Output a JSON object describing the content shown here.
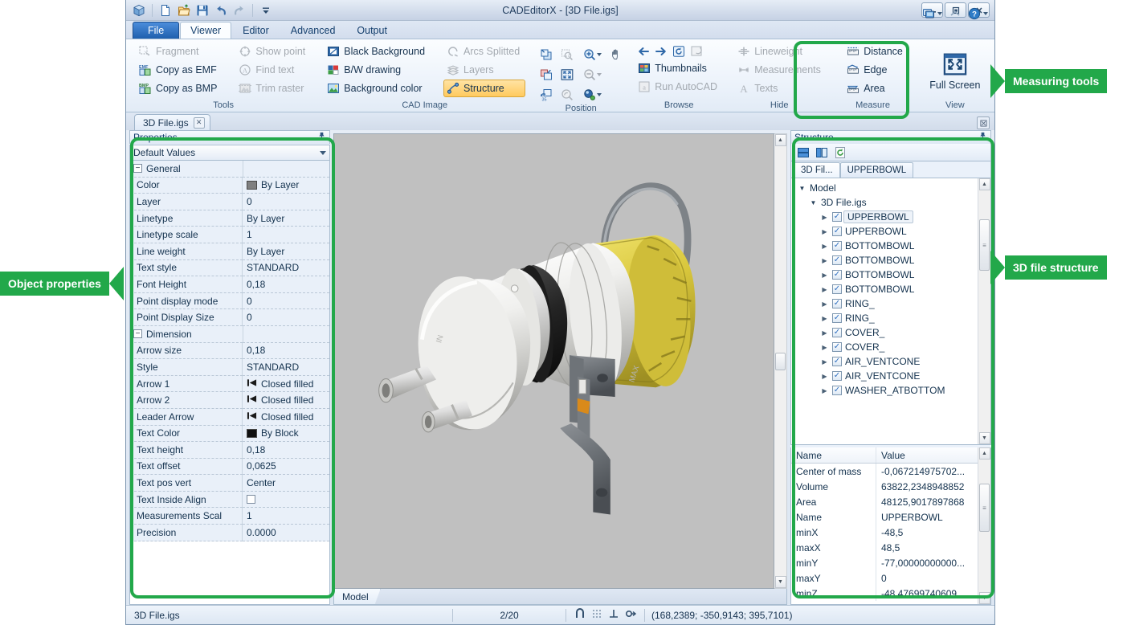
{
  "window": {
    "title": "CADEditorX - [3D File.igs]",
    "minimize": "—",
    "maximize": "□",
    "close": "✕"
  },
  "quick_access": {
    "items": [
      "app-logo",
      "new-file",
      "open-file",
      "save-file",
      "undo",
      "redo",
      "customize-qat"
    ]
  },
  "ribbon": {
    "tabs": [
      {
        "label": "File",
        "kind": "file"
      },
      {
        "label": "Viewer",
        "kind": "active"
      },
      {
        "label": "Editor",
        "kind": "normal"
      },
      {
        "label": "Advanced",
        "kind": "normal"
      },
      {
        "label": "Output",
        "kind": "normal"
      }
    ],
    "groups": [
      {
        "name": "Tools",
        "label": "Tools",
        "columns": [
          [
            {
              "label": "Fragment",
              "icon": "fragment-icon",
              "state": "disabled"
            },
            {
              "label": "Copy as EMF",
              "icon": "copy-emf-icon",
              "state": "normal"
            },
            {
              "label": "Copy as BMP",
              "icon": "copy-bmp-icon",
              "state": "normal"
            }
          ],
          [
            {
              "label": "Show point",
              "icon": "show-point-icon",
              "state": "disabled"
            },
            {
              "label": "Find text",
              "icon": "find-text-icon",
              "state": "disabled"
            },
            {
              "label": "Trim raster",
              "icon": "trim-raster-icon",
              "state": "disabled"
            }
          ]
        ]
      },
      {
        "name": "CAD Image",
        "label": "CAD Image",
        "columns": [
          [
            {
              "label": "Black Background",
              "icon": "black-background-icon",
              "state": "normal"
            },
            {
              "label": "B/W drawing",
              "icon": "bw-drawing-icon",
              "state": "normal"
            },
            {
              "label": "Background color",
              "icon": "background-color-icon",
              "state": "normal"
            }
          ],
          [
            {
              "label": "Arcs Splitted",
              "icon": "arcs-splitted-icon",
              "state": "disabled"
            },
            {
              "label": "Layers",
              "icon": "layers-icon",
              "state": "disabled"
            },
            {
              "label": "Structure",
              "icon": "structure-icon",
              "state": "toggled"
            }
          ]
        ]
      },
      {
        "name": "Position",
        "label": "Position",
        "buttons": [
          [
            "pan-region-icon",
            "zoom-window-icon",
            "zoom-in-icon",
            "hand-pan-icon"
          ],
          [
            "copy-view-icon",
            "fit-all-icon",
            "zoom-out-icon"
          ],
          [
            "rotate-35-icon",
            "zoom-previous-icon",
            "zoom-dynamic-icon"
          ]
        ]
      },
      {
        "name": "Browse",
        "label": "Browse",
        "nav": [
          "back-arrow-icon",
          "forward-arrow-icon",
          "refresh-view-icon",
          "window-view-icon"
        ],
        "columns": [
          [
            {
              "label": "Thumbnails",
              "icon": "thumbnails-icon",
              "state": "normal"
            },
            {
              "label": "Run AutoCAD",
              "icon": "run-autocad-icon",
              "state": "disabled"
            }
          ]
        ]
      },
      {
        "name": "Hide",
        "label": "Hide",
        "columns": [
          [
            {
              "label": "Lineweight",
              "icon": "lineweight-icon",
              "state": "disabled"
            },
            {
              "label": "Measurements",
              "icon": "measurements-icon",
              "state": "disabled"
            },
            {
              "label": "Texts",
              "icon": "texts-icon",
              "state": "disabled"
            }
          ]
        ]
      },
      {
        "name": "Measure",
        "label": "Measure",
        "columns": [
          [
            {
              "label": "Distance",
              "icon": "distance-icon",
              "state": "normal"
            },
            {
              "label": "Edge",
              "icon": "edge-icon",
              "state": "normal"
            },
            {
              "label": "Area",
              "icon": "area-icon",
              "state": "normal"
            }
          ]
        ]
      },
      {
        "name": "View",
        "label": "View",
        "big_button": {
          "label": "Full Screen",
          "icon": "full-screen-icon"
        }
      }
    ],
    "right_tools": [
      "display-options-icon",
      "minimize-ribbon-icon",
      "help-icon"
    ]
  },
  "document_tab": {
    "label": "3D File.igs",
    "close": "✕"
  },
  "properties": {
    "caption": "Properties",
    "selector_value": "Default Values",
    "groups": [
      {
        "name": "General",
        "rows": [
          {
            "name": "Color",
            "value": "By Layer",
            "kind": "color",
            "color": "#808080"
          },
          {
            "name": "Layer",
            "value": "0",
            "kind": "text"
          },
          {
            "name": "Linetype",
            "value": "By Layer",
            "kind": "text"
          },
          {
            "name": "Linetype scale",
            "value": "1",
            "kind": "text"
          },
          {
            "name": "Line weight",
            "value": "By Layer",
            "kind": "text"
          },
          {
            "name": "Text style",
            "value": "STANDARD",
            "kind": "text"
          },
          {
            "name": "Font Height",
            "value": "0,18",
            "kind": "text"
          },
          {
            "name": "Point display mode",
            "value": "0",
            "kind": "text"
          },
          {
            "name": "Point Display Size",
            "value": "0",
            "kind": "text"
          }
        ]
      },
      {
        "name": "Dimension",
        "rows": [
          {
            "name": "Arrow size",
            "value": "0,18",
            "kind": "text"
          },
          {
            "name": "Style",
            "value": "STANDARD",
            "kind": "text"
          },
          {
            "name": "Arrow 1",
            "value": "Closed filled",
            "kind": "arrow"
          },
          {
            "name": "Arrow 2",
            "value": "Closed filled",
            "kind": "arrow"
          },
          {
            "name": "Leader Arrow",
            "value": "Closed filled",
            "kind": "arrow"
          },
          {
            "name": "Text Color",
            "value": "By Block",
            "kind": "color",
            "color": "#101010"
          },
          {
            "name": "Text height",
            "value": "0,18",
            "kind": "text"
          },
          {
            "name": "Text offset",
            "value": "0,0625",
            "kind": "text"
          },
          {
            "name": "Text pos vert",
            "value": "Center",
            "kind": "text"
          },
          {
            "name": "Text Inside Align",
            "value": "",
            "kind": "checkbox"
          },
          {
            "name": "Measurements Scal",
            "value": "1",
            "kind": "text"
          },
          {
            "name": "Precision",
            "value": "0.0000",
            "kind": "text"
          }
        ]
      }
    ]
  },
  "viewport": {
    "model_tab": "Model",
    "scroll_up": "▲",
    "scroll_down": "▼"
  },
  "structure": {
    "caption": "Structure",
    "toolbar": [
      "split-horizontal-icon",
      "split-vertical-icon",
      "refresh-structure-icon"
    ],
    "tabs": [
      {
        "label": "3D Fil...",
        "active": true
      },
      {
        "label": "UPPERBOWL",
        "active": false
      }
    ],
    "tree": [
      {
        "label": "Model",
        "depth": 0,
        "arrow": "down",
        "checkbox": false,
        "selected": false
      },
      {
        "label": "3D File.igs",
        "depth": 1,
        "arrow": "down",
        "checkbox": false,
        "selected": false
      },
      {
        "label": "UPPERBOWL",
        "depth": 2,
        "arrow": "right",
        "checkbox": true,
        "selected": true
      },
      {
        "label": "UPPERBOWL",
        "depth": 2,
        "arrow": "right",
        "checkbox": true,
        "selected": false
      },
      {
        "label": "BOTTOMBOWL",
        "depth": 2,
        "arrow": "right",
        "checkbox": true,
        "selected": false
      },
      {
        "label": "BOTTOMBOWL",
        "depth": 2,
        "arrow": "right",
        "checkbox": true,
        "selected": false
      },
      {
        "label": "BOTTOMBOWL",
        "depth": 2,
        "arrow": "right",
        "checkbox": true,
        "selected": false
      },
      {
        "label": "BOTTOMBOWL",
        "depth": 2,
        "arrow": "right",
        "checkbox": true,
        "selected": false
      },
      {
        "label": "RING_",
        "depth": 2,
        "arrow": "right",
        "checkbox": true,
        "selected": false
      },
      {
        "label": "RING_",
        "depth": 2,
        "arrow": "right",
        "checkbox": true,
        "selected": false
      },
      {
        "label": "COVER_",
        "depth": 2,
        "arrow": "right",
        "checkbox": true,
        "selected": false
      },
      {
        "label": "COVER_",
        "depth": 2,
        "arrow": "right",
        "checkbox": true,
        "selected": false
      },
      {
        "label": "AIR_VENTCONE",
        "depth": 2,
        "arrow": "right",
        "checkbox": true,
        "selected": false
      },
      {
        "label": "AIR_VENTCONE",
        "depth": 2,
        "arrow": "right",
        "checkbox": true,
        "selected": false
      },
      {
        "label": "WASHER_ATBOTTOM",
        "depth": 2,
        "arrow": "right",
        "checkbox": true,
        "selected": false
      }
    ],
    "value_table": {
      "headers": [
        "Name",
        "Value"
      ],
      "rows": [
        [
          "Center of mass",
          "-0,067214975702..."
        ],
        [
          "Volume",
          "63822,2348948852"
        ],
        [
          "Area",
          "48125,9017897868"
        ],
        [
          "Name",
          "UPPERBOWL"
        ],
        [
          "minX",
          "-48,5"
        ],
        [
          "maxX",
          "48,5"
        ],
        [
          "minY",
          "-77,00000000000..."
        ],
        [
          "maxY",
          "0"
        ],
        [
          "minZ",
          "-48,47699740609..."
        ]
      ]
    }
  },
  "statusbar": {
    "filename": "3D File.igs",
    "page": "2/20",
    "icons": [
      "snap-icon",
      "grid-icon",
      "ortho-icon",
      "osnap-icon"
    ],
    "coordinates": "(168,2389; -350,9143; 395,7101)"
  },
  "annotations": [
    {
      "text": "Measuring tools",
      "dir": "left"
    },
    {
      "text": "3D file structure",
      "dir": "left"
    },
    {
      "text": "Object properties",
      "dir": "right"
    }
  ],
  "colors": {
    "highlight": "#22a84a",
    "accent": "#1f5fad",
    "toggle": "#ffca5e",
    "canvas": "#c0c0c0"
  }
}
